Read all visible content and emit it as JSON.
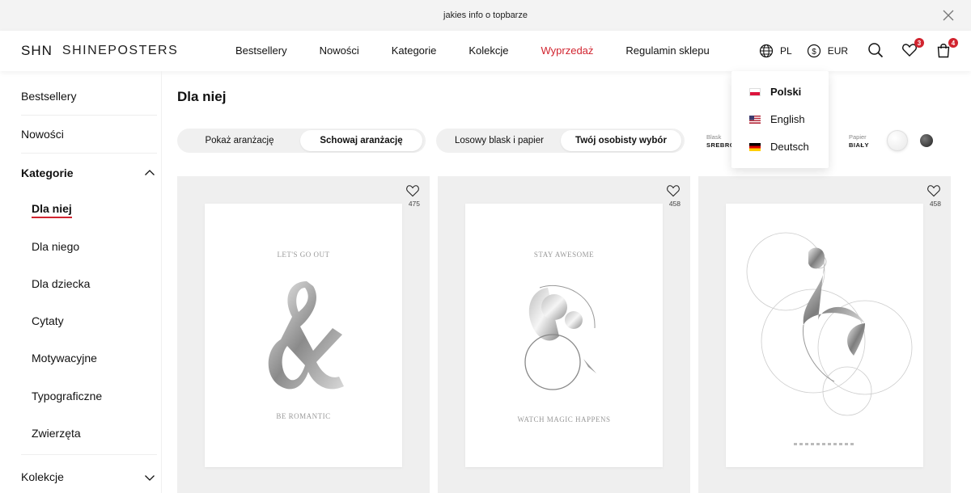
{
  "topbar": {
    "text": "jakies info o topbarze",
    "close_icon": "close-icon"
  },
  "header": {
    "logo_mark": "SHN",
    "logo_text": "SHINEPOSTERS",
    "nav": [
      "Bestsellery",
      "Nowości",
      "Kategorie",
      "Kolekcje",
      "Wyprzedaż",
      "Regulamin sklepu"
    ],
    "language": "PL",
    "currency": "EUR",
    "wishlist_count": "3",
    "cart_count": "4",
    "accent_color": "#d1242f"
  },
  "language_menu": {
    "items": [
      {
        "label": "Polski",
        "flag": "flag-pl-icon",
        "selected": true
      },
      {
        "label": "English",
        "flag": "flag-us-icon",
        "selected": false
      },
      {
        "label": "Deutsch",
        "flag": "flag-de-icon",
        "selected": false
      }
    ]
  },
  "sidebar": {
    "bestsellery": "Bestsellery",
    "nowosci": "Nowości",
    "kategorie": "Kategorie",
    "subcategories": [
      "Dla niej",
      "Dla niego",
      "Dla dziecka",
      "Cytaty",
      "Motywacyjne",
      "Typograficzne",
      "Zwierzęta"
    ],
    "kolekcje": "Kolekcje"
  },
  "main": {
    "title": "Dla niej",
    "arrangement_toggle": {
      "left": "Pokaż aranżację",
      "right": "Schowaj aranżację",
      "selected": "right"
    },
    "selection_toggle": {
      "left": "Losowy blask i papier",
      "right": "Twój osobisty wybór",
      "selected": "right"
    },
    "shine_label": "Blask",
    "shine_value": "SREBRO",
    "paper_label": "Papier",
    "paper_value": "BIAŁY"
  },
  "products": [
    {
      "likes": "475",
      "top_text": "LET'S GO OUT",
      "bottom_text": "BE ROMANTIC"
    },
    {
      "likes": "458",
      "top_text": "STAY AWESOME",
      "bottom_text": "WATCH MAGIC HAPPENS"
    },
    {
      "likes": "458",
      "top_text": "",
      "bottom_text": ""
    }
  ]
}
